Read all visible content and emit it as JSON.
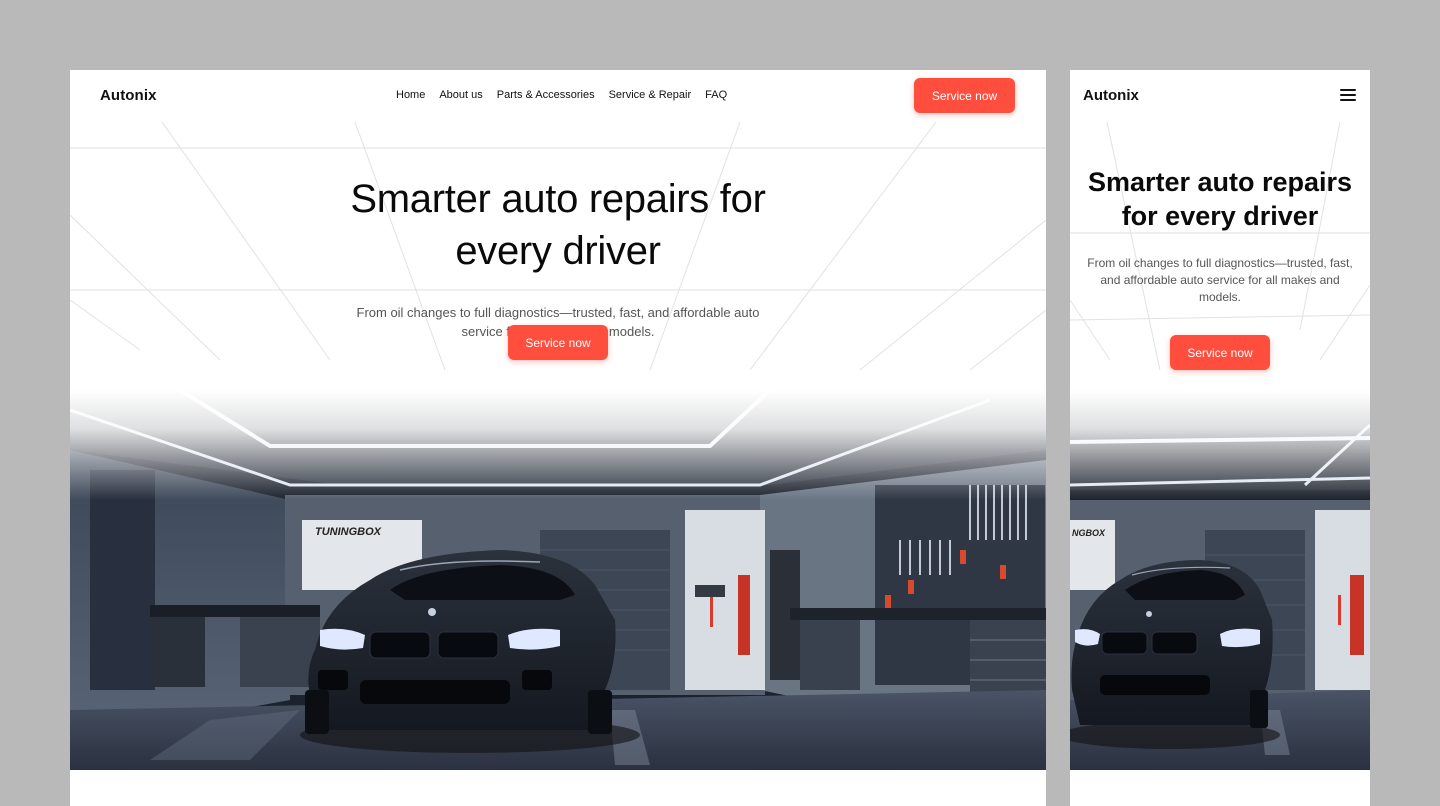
{
  "brand": "Autonix",
  "nav": {
    "items": [
      "Home",
      "About us",
      "Parts & Accessories",
      "Service & Repair",
      "FAQ"
    ],
    "cta_label": "Service now"
  },
  "hero": {
    "title": "Smarter auto repairs for every driver",
    "subtitle": "From oil changes to full diagnostics—trusted, fast, and affordable auto service for all makes and models.",
    "cta_label": "Service now",
    "image_alt": "Black sports car in a modern garage with tools on the wall",
    "sign_text": "TUNINGBOX"
  },
  "mobile": {
    "brand": "Autonix",
    "title": "Smarter auto repairs for every driver",
    "subtitle": "From oil changes to full diagnostics—trusted, fast, and affordable auto service for all makes and models.",
    "cta_label": "Service now",
    "menu_icon": "hamburger-menu-icon",
    "sign_text": "NGBOX"
  },
  "colors": {
    "accent": "#ff4d3e",
    "background": "#b9b9b9",
    "text": "#0a0a0a"
  }
}
